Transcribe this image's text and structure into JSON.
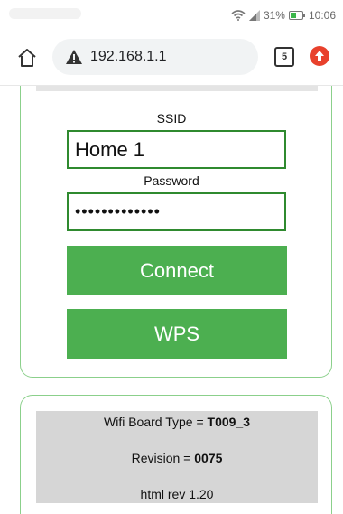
{
  "status_bar": {
    "battery_percent": "31%",
    "time": "10:06",
    "icons": [
      "wifi-icon",
      "signal-icon",
      "battery-icon"
    ]
  },
  "browser": {
    "url": "192.168.1.1",
    "tab_count": "5",
    "icons": [
      "home-icon",
      "not-secure-warning-icon",
      "tab-switcher-icon",
      "update-icon"
    ]
  },
  "form": {
    "ssid_label": "SSID",
    "ssid_value": "Home 1",
    "password_label": "Password",
    "password_value": "•••••••••••••",
    "connect_label": "Connect",
    "wps_label": "WPS"
  },
  "info": {
    "board_type_label": "Wifi Board Type = ",
    "board_type_value": "T009_3",
    "revision_label": "Revision = ",
    "revision_value": "0075",
    "html_rev": "html rev 1.20"
  },
  "colors": {
    "accent_green": "#4caf50",
    "field_border": "#2f8a2f",
    "card_border": "#8bd08b",
    "info_bg": "#d6d6d6",
    "update_red": "#e8412c"
  }
}
